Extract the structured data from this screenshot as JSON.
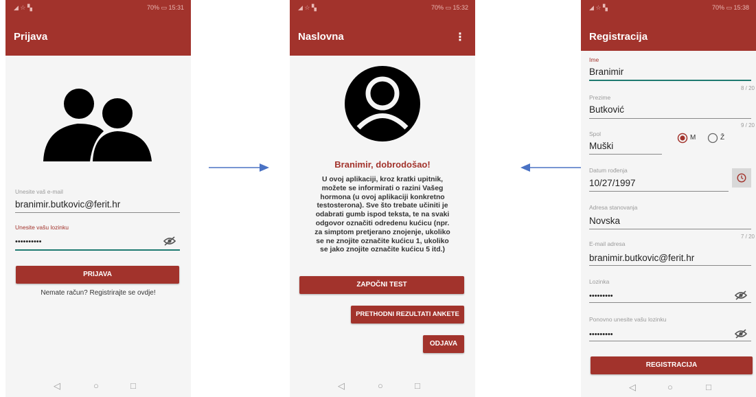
{
  "statusbar": {
    "signal": "◢ ☆ ▚",
    "left": {
      "battery": "70%",
      "time": "15:31"
    },
    "middle": {
      "battery": "70%",
      "time": "15:32"
    },
    "right": {
      "battery": "70%",
      "time": "15:38"
    }
  },
  "nav": {
    "back": "◁",
    "home": "○",
    "recent": "□"
  },
  "login": {
    "title": "Prijava",
    "email_label": "Unesite vaš e-mail",
    "email_value": "branimir.butkovic@ferit.hr",
    "password_label": "Unesite vašu lozinku",
    "password_value": "••••••••••",
    "login_button": "PRIJAVA",
    "register_link": "Nemate račun? Registrirajte se ovdje!"
  },
  "home": {
    "title": "Naslovna",
    "greeting": "Branimir, dobrodošao!",
    "intro_lines": [
      "U ovoj aplikaciji, kroz kratki upitnik,",
      "možete se informirati o razini Vašeg",
      "hormona (u ovoj aplikaciji konkretno",
      "testosterona). Sve što trebate učiniti je",
      "odabrati gumb ispod teksta, te na svaki",
      "odgovor označiti odredenu kućicu (npr.",
      "za simptom pretjerano znojenje, ukoliko",
      "se ne znojite označite kućicu 1, ukoliko",
      "se jako znojite označite kućicu 5 itd.)"
    ],
    "start_button": "ZAPOČNI TEST",
    "previous_button": "PRETHODNI REZULTATI ANKETE",
    "logout_button": "ODJAVA"
  },
  "register": {
    "title": "Registracija",
    "name_label": "Ime",
    "name_value": "Branimir",
    "name_counter": "8 / 20",
    "surname_label": "Prezime",
    "surname_value": "Butković",
    "surname_counter": "9 / 20",
    "gender_label": "Spol",
    "gender_value": "Muški",
    "gender_m": "M",
    "gender_z": "Ž",
    "dob_label": "Datum rođenja",
    "dob_value": "10/27/1997",
    "address_label": "Adresa stanovanja",
    "address_value": "Novska",
    "address_counter": "7 / 20",
    "email_label": "E-mail adresa",
    "email_value": "branimir.butkovic@ferit.hr",
    "password_label": "Lozinka",
    "password_value": "•••••••••",
    "repeat_label": "Ponovno unesite vašu lozinku",
    "repeat_value": "•••••••••",
    "register_button": "REGISTRACIJA"
  },
  "colors": {
    "primary": "#a2332c",
    "accent": "#1e7a70",
    "arrow": "#4a72c4"
  }
}
